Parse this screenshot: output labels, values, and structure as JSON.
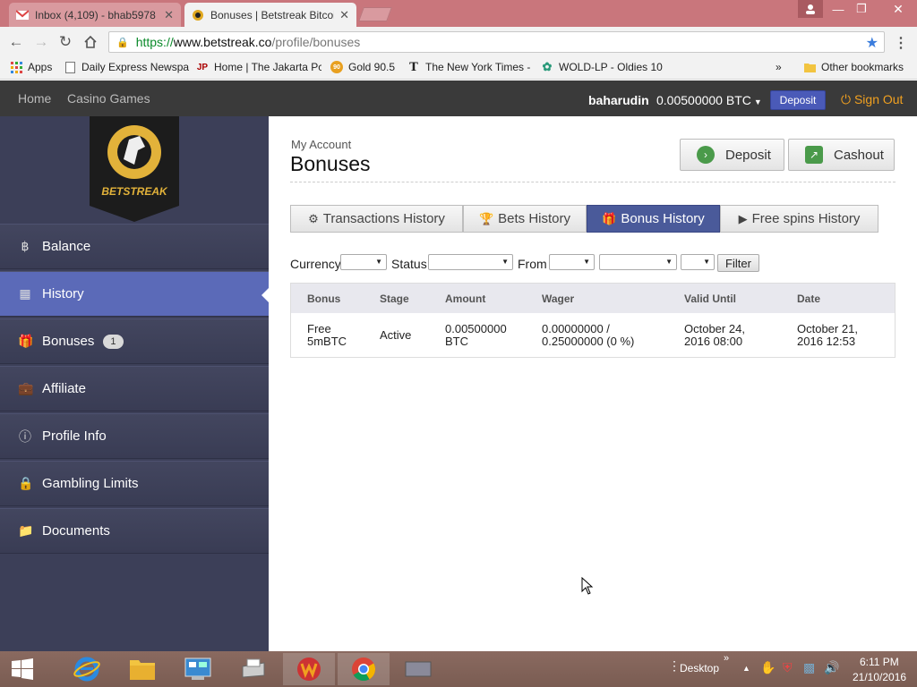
{
  "browser": {
    "tabs": [
      {
        "title": "Inbox (4,109) - bhab5978",
        "close": "✕"
      },
      {
        "title": "Bonuses | Betstreak Bitcoi",
        "close": "✕"
      }
    ],
    "url": {
      "scheme": "https://",
      "host": "www.betstreak.co",
      "path": "/profile/bonuses"
    },
    "bookmarks": [
      {
        "label": "Apps",
        "icon": "apps-grid-icon"
      },
      {
        "label": "Daily Express Newspa",
        "icon": "page-icon"
      },
      {
        "label": "Home | The Jakarta Pc",
        "icon": "jp-icon"
      },
      {
        "label": "Gold 90.5",
        "icon": "gold-icon"
      },
      {
        "label": "The New York Times -",
        "icon": "nyt-icon"
      },
      {
        "label": "WOLD-LP - Oldies 10",
        "icon": "radio-icon"
      }
    ],
    "bookmarks_overflow": "»",
    "other_bookmarks": "Other bookmarks"
  },
  "site": {
    "nav": {
      "home": "Home",
      "casino": "Casino Games"
    },
    "user": {
      "name": "baharudin",
      "balance": "0.00500000 BTC",
      "deposit": "Deposit",
      "sign_out": "Sign Out"
    },
    "logo_text": "BETSTREAK",
    "sidebar": [
      {
        "label": "Balance",
        "icon": "bitcoin-icon"
      },
      {
        "label": "History",
        "icon": "calendar-icon",
        "active": true
      },
      {
        "label": "Bonuses",
        "icon": "gift-icon",
        "badge": "1"
      },
      {
        "label": "Affiliate",
        "icon": "briefcase-icon"
      },
      {
        "label": "Profile Info",
        "icon": "info-icon"
      },
      {
        "label": "Gambling Limits",
        "icon": "lock-icon"
      },
      {
        "label": "Documents",
        "icon": "folder-icon"
      }
    ],
    "breadcrumb": "My Account",
    "title": "Bonuses",
    "actions": {
      "deposit": "Deposit",
      "cashout": "Cashout"
    },
    "history_tabs": [
      {
        "label": "Transactions History",
        "icon": "gear-icon"
      },
      {
        "label": "Bets History",
        "icon": "trophy-icon"
      },
      {
        "label": "Bonus History",
        "icon": "gift-icon",
        "active": true
      },
      {
        "label": "Free spins History",
        "icon": "play-icon"
      }
    ],
    "filter": {
      "currency": "Currency",
      "status": "Status",
      "from": "From",
      "button": "Filter"
    },
    "table": {
      "headers": [
        "Bonus",
        "Stage",
        "Amount",
        "Wager",
        "Valid Until",
        "Date"
      ],
      "rows": [
        {
          "bonus": [
            "Free",
            "5mBTC"
          ],
          "stage": "Active",
          "amount": [
            "0.00500000",
            "BTC"
          ],
          "wager": [
            "0.00000000 /",
            "0.25000000 (0 %)"
          ],
          "valid_until": [
            "October 24,",
            "2016 08:00"
          ],
          "date": [
            "October 21,",
            "2016 12:53"
          ]
        }
      ]
    }
  },
  "taskbar": {
    "desktop": "Desktop",
    "time": "6:11 PM",
    "date": "21/10/2016"
  },
  "colors": {
    "accent": "#5b6ab8",
    "sidebar": "#3c3f58",
    "signout": "#f0a020",
    "titlebar": "#c9767c"
  }
}
